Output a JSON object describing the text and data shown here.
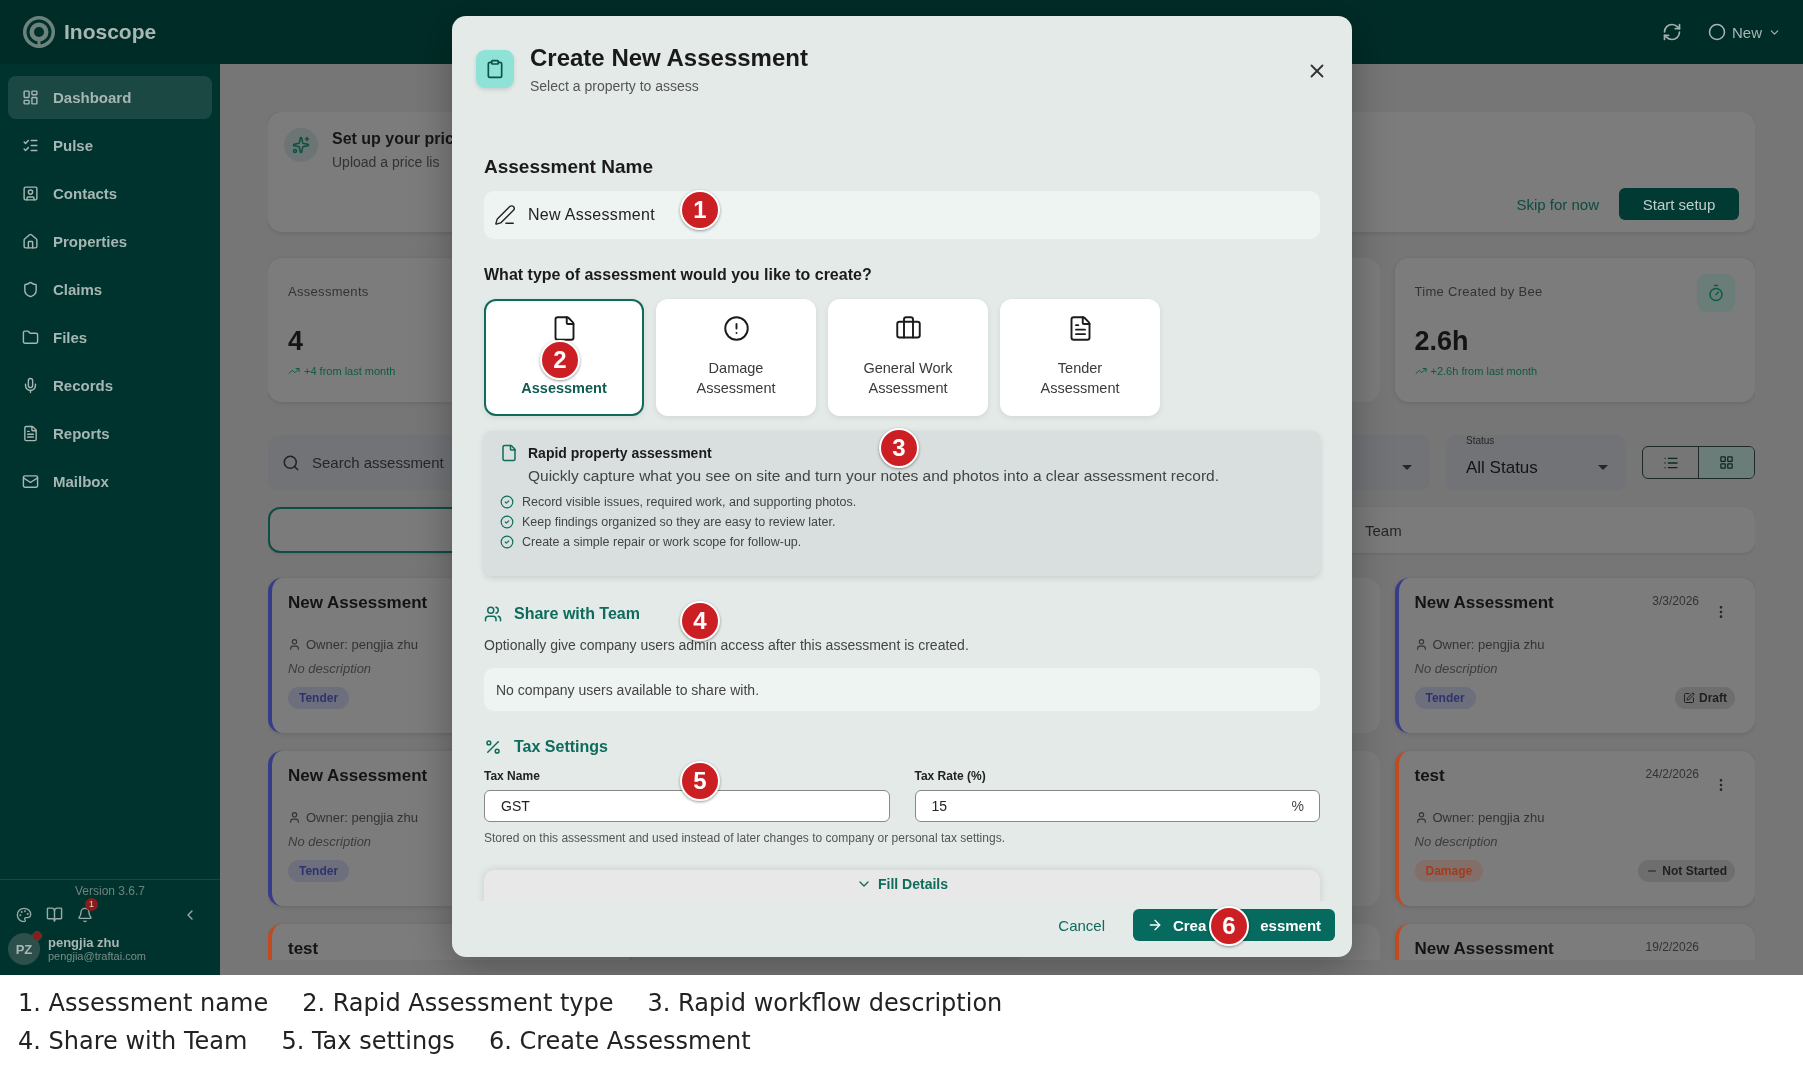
{
  "app": {
    "name": "Inoscope"
  },
  "topbar": {
    "new_button": "New"
  },
  "sidebar": {
    "items": [
      {
        "label": "Dashboard",
        "selected": true
      },
      {
        "label": "Pulse",
        "selected": false
      },
      {
        "label": "Contacts",
        "selected": false
      },
      {
        "label": "Properties",
        "selected": false
      },
      {
        "label": "Claims",
        "selected": false
      },
      {
        "label": "Files",
        "selected": false
      },
      {
        "label": "Records",
        "selected": false
      },
      {
        "label": "Reports",
        "selected": false
      },
      {
        "label": "Mailbox",
        "selected": false
      }
    ],
    "version": "Version 3.6.7",
    "notification_count": "1",
    "user": {
      "initials": "PZ",
      "name": "pengjia zhu",
      "email": "pengjia@traftai.com",
      "has_alert": true
    }
  },
  "setup_banner": {
    "title": "Set up your pric",
    "subtitle": "Upload a price lis",
    "skip": "Skip for now",
    "start": "Start setup"
  },
  "stats": [
    {
      "kind": "count",
      "label": "Assessments",
      "value": "4",
      "trend": "+4 from last month"
    },
    {
      "kind": "time",
      "label": "Time Created by Bee",
      "value": "2.6h",
      "trend": "+2.6h from last month"
    }
  ],
  "filters": {
    "search_placeholder": "Search assessment",
    "status_label": "Status",
    "status_value": "All Status",
    "views": [
      {
        "kind": "list",
        "selected": false
      },
      {
        "kind": "grid",
        "selected": true
      }
    ]
  },
  "tabs": [
    {
      "selected": true
    },
    {
      "label": "Team",
      "selected": false
    }
  ],
  "card_rows": [
    {
      "left": {
        "kind": "tender",
        "title": "New Assessment",
        "owner": "Owner: pengjia zhu",
        "description": "No description",
        "type_badge": "Tender"
      },
      "right": {
        "kind": "tender",
        "title": "New Assessment",
        "date": "3/3/2026",
        "owner": "Owner: pengjia zhu",
        "description": "No description",
        "type_badge": "Tender",
        "status": {
          "kind": "draft",
          "label": "Draft"
        }
      }
    },
    {
      "left": {
        "kind": "tender",
        "title": "New Assessment",
        "owner": "Owner: pengjia zhu",
        "description": "No description",
        "type_badge": "Tender"
      },
      "right": {
        "kind": "damage",
        "title": "test",
        "date": "24/2/2026",
        "owner": "Owner: pengjia zhu",
        "description": "No description",
        "type_badge": "Damage",
        "status": {
          "kind": "not_started",
          "label": "Not Started"
        }
      }
    },
    {
      "left": {
        "kind": "damage",
        "title": "test"
      },
      "right": {
        "kind": "damage",
        "title": "New Assessment",
        "date": "19/2/2026"
      }
    }
  ],
  "modal": {
    "title": "Create New Assessment",
    "subtitle": "Select a property to assess",
    "name_label": "Assessment Name",
    "name_value": "New Assessment",
    "type_question": "What type of assessment would you like to create?",
    "types": [
      {
        "kind": "rapid",
        "label": "Assessment",
        "selected": true
      },
      {
        "kind": "damage",
        "label": "Damage Assessment",
        "selected": false
      },
      {
        "kind": "general",
        "label": "General Work Assessment",
        "selected": false
      },
      {
        "kind": "tender",
        "label": "Tender Assessment",
        "selected": false
      }
    ],
    "detail": {
      "title": "Rapid property assessment",
      "description": "Quickly capture what you see on site and turn your notes and photos into a clear assessment record.",
      "points": [
        "Record visible issues, required work, and supporting photos.",
        "Keep findings organized so they are easy to review later.",
        "Create a simple repair or work scope for follow-up."
      ]
    },
    "share": {
      "title": "Share with Team",
      "description": "Optionally give company users admin access after this assessment is created.",
      "empty": "No company users available to share with."
    },
    "tax": {
      "title": "Tax Settings",
      "name_label": "Tax Name",
      "name_value": "GST",
      "rate_label": "Tax Rate (%)",
      "rate_value": "15",
      "rate_suffix": "%",
      "helper": "Stored on this assessment and used instead of later changes to company or personal tax settings."
    },
    "fill_details": "Fill Details",
    "cancel": "Cancel",
    "create": [
      "Crea",
      "essment"
    ]
  },
  "annotations": [
    "1",
    "2",
    "3",
    "4",
    "5",
    "6"
  ],
  "caption": {
    "lines": [
      [
        "1. Assessment name",
        "2. Rapid Assessment type",
        "3. Rapid workflow description"
      ],
      [
        "4. Share with Team",
        "5. Tax settings",
        "6. Create Assessment"
      ]
    ]
  }
}
